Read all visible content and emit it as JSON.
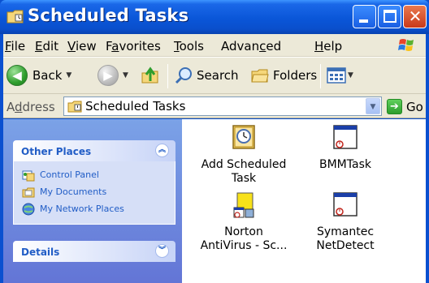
{
  "window": {
    "title": "Scheduled Tasks"
  },
  "menu": {
    "items": [
      {
        "label": "File",
        "u": "F",
        "rest": "ile"
      },
      {
        "label": "Edit",
        "u": "E",
        "rest": "dit"
      },
      {
        "label": "View",
        "u": "V",
        "rest": "iew"
      },
      {
        "label": "Favorites",
        "pre": "F",
        "u": "a",
        "rest": "vorites"
      },
      {
        "label": "Tools",
        "u": "T",
        "rest": "ools"
      },
      {
        "label": "Advanced",
        "pre": "Advan",
        "u": "c",
        "rest": "ed"
      },
      {
        "label": "Help",
        "u": "H",
        "rest": "elp"
      }
    ]
  },
  "toolbar": {
    "back_label": "Back",
    "search_label": "Search",
    "folders_label": "Folders"
  },
  "address": {
    "label_pre": "A",
    "label_u": "d",
    "label_rest": "dress",
    "value": "Scheduled Tasks",
    "go_label": "Go"
  },
  "taskpane": {
    "other_places": {
      "title": "Other Places",
      "links": [
        "Control Panel",
        "My Documents",
        "My Network Places"
      ]
    },
    "details": {
      "title": "Details"
    }
  },
  "items": [
    {
      "line1": "Add Scheduled",
      "line2": "Task"
    },
    {
      "line1": "BMMTask",
      "line2": ""
    },
    {
      "line1": "Norton",
      "line2": "AntiVirus - Sc..."
    },
    {
      "line1": "Symantec",
      "line2": "NetDetect"
    }
  ],
  "colors": {
    "title_bar": "#0a56d8",
    "link": "#215dc6",
    "close_button": "#c9391a"
  }
}
